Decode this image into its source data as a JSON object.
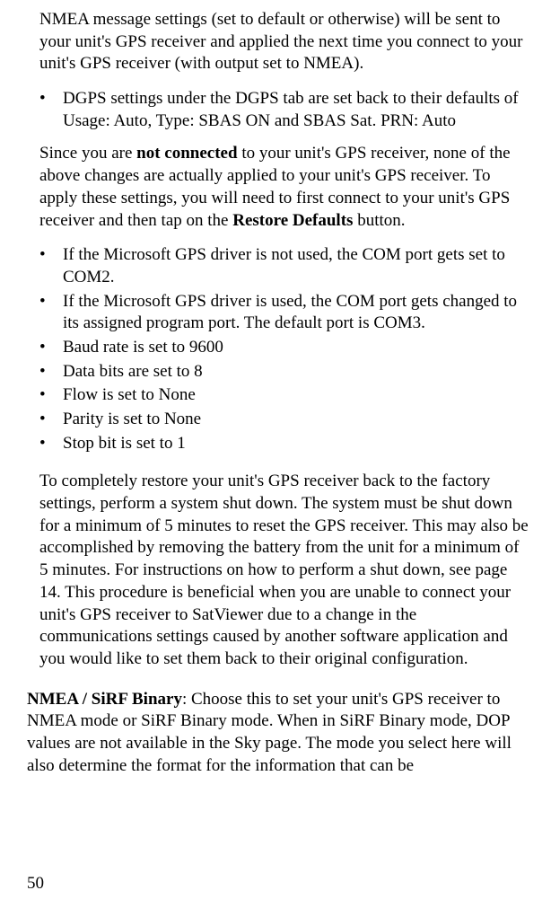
{
  "top_paragraph": "NMEA message settings (set to default or otherwise) will be sent to your unit's GPS receiver and applied the next time you connect to your unit's GPS receiver (with output set to NMEA).",
  "bullet_group_1": {
    "items": [
      "DGPS settings under the DGPS tab are set back to their defaults of Usage: Auto, Type: SBAS ON and SBAS Sat. PRN: Auto"
    ]
  },
  "middle_paragraph": {
    "pre": "Since you are ",
    "bold1": "not connected",
    "mid": " to your unit's GPS receiver, none of the above changes are actually applied to your unit's GPS receiver. To apply these settings, you will need to first connect to your unit's GPS receiver and then tap on the ",
    "bold2": "Restore Defaults",
    "post": " button."
  },
  "bullet_group_2": {
    "items": [
      "If the Microsoft GPS driver is not used, the COM port gets set to COM2.",
      "If the Microsoft GPS driver is used, the COM port gets changed to its assigned program port. The default port is COM3.",
      "Baud rate is set to 9600",
      "Data bits are set to 8",
      "Flow is set to None",
      "Parity is set to None",
      "Stop bit is set to 1"
    ]
  },
  "restore_paragraph": "To completely restore your unit's GPS receiver back to the factory settings, perform a system shut down. The system must be shut down for a minimum of 5 minutes to reset the GPS receiver. This may also be accomplished by removing the battery from the unit for a minimum of 5 minutes. For instructions on how to perform a shut down, see page 14. This procedure is beneficial when you are unable to connect your unit's GPS receiver to SatViewer due to a change in the communications settings caused by another software application and you would like to set them back to their original configuration.",
  "nmea_paragraph": {
    "bold": "NMEA / SiRF Binary",
    "rest": ": Choose this to set your unit's GPS receiver to NMEA mode or SiRF Binary mode. When in SiRF Binary mode, DOP values are not available in the Sky page. The mode you select here will also determine the format for the information that can be"
  },
  "page_number": "50"
}
